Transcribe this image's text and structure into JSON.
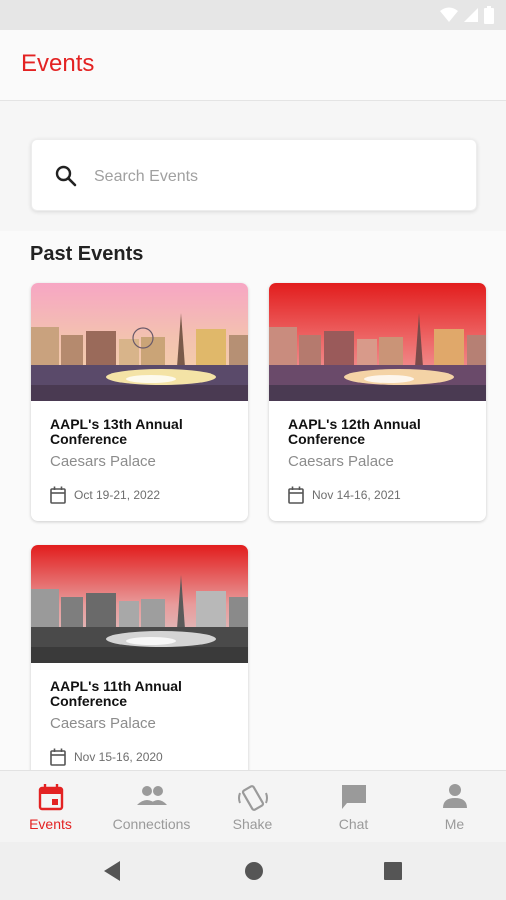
{
  "app": {
    "title": "Events"
  },
  "search": {
    "placeholder": "Search Events"
  },
  "section": {
    "title": "Past Events"
  },
  "events": [
    {
      "title": "AAPL's 13th Annual Conference",
      "venue": "Caesars Palace",
      "date": "Oct 19-21, 2022",
      "image_style": "color"
    },
    {
      "title": "AAPL's 12th Annual Conference",
      "venue": "Caesars Palace",
      "date": "Nov 14-16, 2021",
      "image_style": "red-tint"
    },
    {
      "title": "AAPL's 11th Annual Conference",
      "venue": "Caesars Palace",
      "date": "Nov 15-16, 2020",
      "image_style": "red-grayscale"
    }
  ],
  "nav": {
    "items": [
      {
        "label": "Events",
        "icon": "calendar-icon",
        "active": true
      },
      {
        "label": "Connections",
        "icon": "people-icon",
        "active": false
      },
      {
        "label": "Shake",
        "icon": "shake-phone-icon",
        "active": false
      },
      {
        "label": "Chat",
        "icon": "chat-icon",
        "active": false
      },
      {
        "label": "Me",
        "icon": "person-icon",
        "active": false
      }
    ]
  },
  "colors": {
    "accent": "#e32222",
    "inactive": "#9a9a9a"
  }
}
